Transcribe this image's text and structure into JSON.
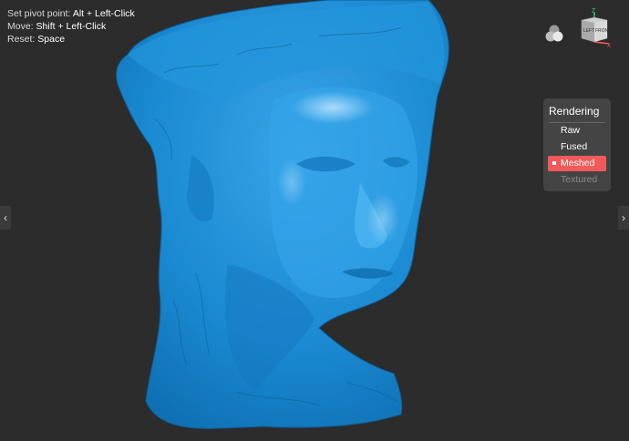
{
  "help": {
    "pivot_label": "Set pivot point:",
    "pivot_key": "Alt + Left-Click",
    "move_label": "Move:",
    "move_key": "Shift + Left-Click",
    "reset_label": "Reset:",
    "reset_key": "Space"
  },
  "rendering": {
    "title": "Rendering",
    "options": [
      {
        "label": "Raw",
        "state": "normal"
      },
      {
        "label": "Fused",
        "state": "normal"
      },
      {
        "label": "Meshed",
        "state": "selected"
      },
      {
        "label": "Textured",
        "state": "disabled"
      }
    ]
  },
  "gizmo": {
    "axis_z": "Z",
    "axis_x": "X",
    "face_left": "LEFT",
    "face_front": "FRONT"
  },
  "nav": {
    "prev": "‹",
    "next": "›"
  },
  "colors": {
    "mesh": "#1e8fd6",
    "background": "#2c2c2c",
    "selected_option": "#f05a5a"
  },
  "icons": {
    "layers": "layers-icon",
    "gizmo": "orientation-cube-icon"
  }
}
